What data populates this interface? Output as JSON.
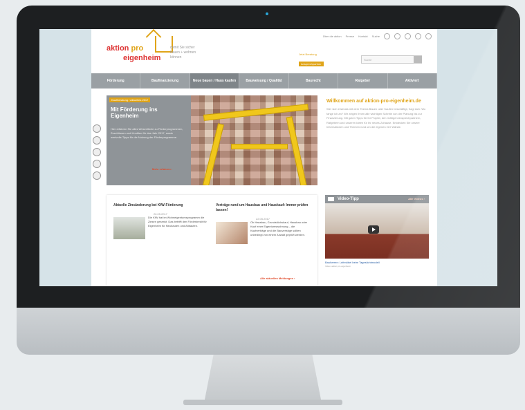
{
  "site": {
    "logo_line1_a": "aktion",
    "logo_line1_b": "pro",
    "logo_line2": "eigenheim",
    "tagline": "damit Sie sicher bauen + wohnen können",
    "toplinks": [
      "Über die aktion",
      "Presse",
      "Kontakt",
      "Suche"
    ],
    "promo_text": "Jetzt Beratung",
    "promo_button": "Ansprechpartner",
    "search_placeholder": "Suche",
    "nav": [
      "Förderung",
      "Baufinanzierung",
      "Neue bauen / Haus kaufen",
      "Bauweisung / Qualität",
      "Baurecht",
      "Ratgeber",
      "Aktiviert"
    ],
    "hero": {
      "tag": "Kaufberatung / Aktuelles 2017",
      "title": "Mit Förderung ins Eigenheim",
      "text": "Hier erfahren Sie alles Wesentliche zu Förderprogrammen, Zuschüssen und Krediten für das Jahr 2017, sowie wertvolle Tipps für die Nutzung der Förderprogramme.",
      "more": "Mehr erfahren ›"
    },
    "welcome": {
      "title": "Willkommen auf aktion-pro-eigenheim.de",
      "text": "Wer sich erstmals mit dem Thema Bauen oder Kaufen beschäftigt, fragt sich: Wo fange ich an? Wir zeigen Ihnen alle wichtigen Schritte von der Planung bis zur Finanzierung. Mit guten Tipps für Ihr Projekt, den richtigen Ansprechpartnern, Ratgebern und unseren Ideen für Ihr neues Zuhause. Entdecken Sie unsere Informationen und Themen rund um die eigenen vier Wände."
    },
    "news": [
      {
        "title": "Aktuelle Zinsänderung bei KfW-Förderung",
        "date": "26.05.2017",
        "text": "Die KfW hat im Wohneigentumsprogramm die Zinsen gesenkt. Das betrifft den Förderkredit für Eigenheim für Neubauten und Altbauten."
      },
      {
        "title": "Verträge rund um Hausbau und Hauskauf: Immer prüfen lassen!",
        "date": "22.05.2017",
        "text": "Ob Hausbau, Grundstückskauf, Hausbau oder Kauf einer Eigentumswohnung – die Kaufverträge und die Bauverträge sollten unbedingt von einem Anwalt geprüft werden."
      }
    ],
    "news_more": "Alle aktuellen Meldungen ›",
    "video": {
      "header": "Video-Tipp",
      "more": "Alle Videos ›",
      "caption": "Bauherren: Leitmöbel beim Tageslichtmodell",
      "sub": "Video: aktion pro eigenheim"
    }
  },
  "colors": {
    "accent": "#e0a418",
    "logo_red": "#d33333",
    "nav_gray": "#9aa0a4",
    "link_red": "#e04a2a"
  }
}
